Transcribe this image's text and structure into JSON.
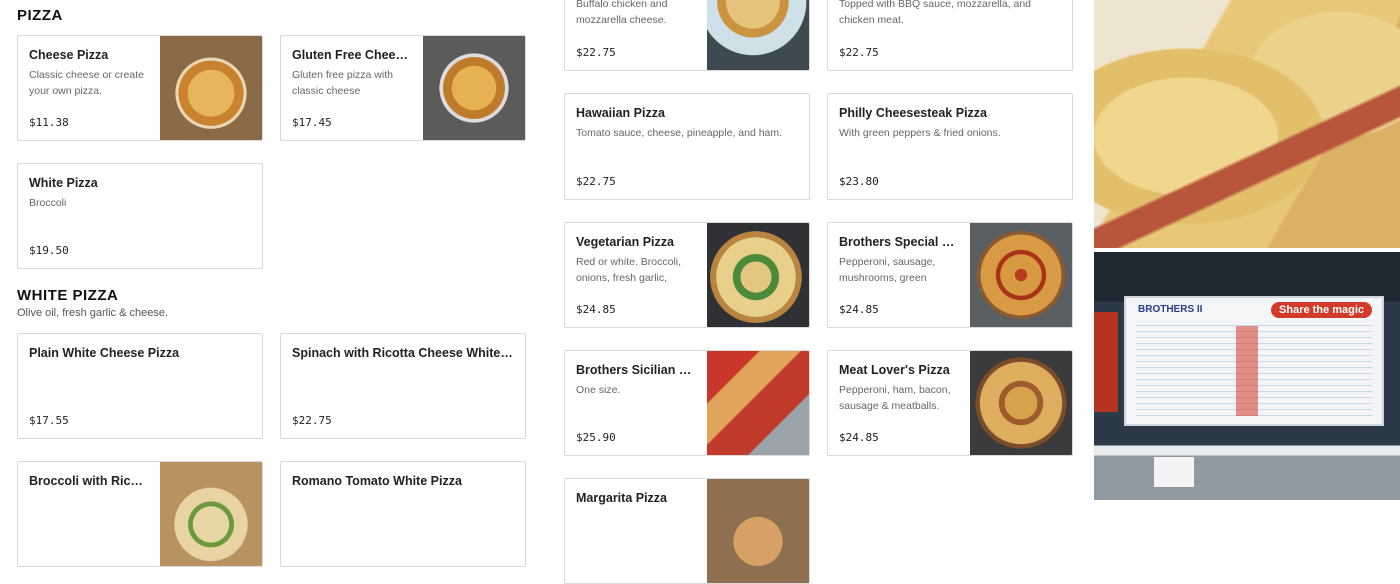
{
  "sections": {
    "pizza": {
      "title": "PIZZA"
    },
    "white_pizza": {
      "title": "WHITE PIZZA",
      "description": "Olive oil, fresh garlic & cheese."
    }
  },
  "items": {
    "cheese_pizza": {
      "name": "Cheese Pizza",
      "description": "Classic cheese or create your own pizza.",
      "price": "$11.38"
    },
    "gluten_free": {
      "name": "Gluten Free Cheese Pizza",
      "description": "Gluten free pizza with classic cheese",
      "price": "$17.45"
    },
    "white_pizza": {
      "name": "White Pizza",
      "description": "Broccoli",
      "price": "$19.50"
    },
    "plain_white": {
      "name": "Plain White Cheese Pizza",
      "description": "",
      "price": "$17.55"
    },
    "spinach_ricotta": {
      "name": "Spinach with Ricotta Cheese White Pizza",
      "description": "",
      "price": "$22.75"
    },
    "broccoli_ricotta": {
      "name": "Broccoli with Ricotta Cheese White Pizza",
      "description": "",
      "price": ""
    },
    "romano_tomato": {
      "name": "Romano Tomato White Pizza",
      "description": "",
      "price": ""
    },
    "buffalo": {
      "name": "",
      "description": "Buffalo chicken and mozzarella cheese.",
      "price": "$22.75"
    },
    "bbq": {
      "name": "",
      "description": "Topped with BBQ sauce, mozzarella, and chicken meat.",
      "price": "$22.75"
    },
    "hawaiian": {
      "name": "Hawaiian Pizza",
      "description": "Tomato sauce, cheese, pineapple, and ham.",
      "price": "$22.75"
    },
    "philly": {
      "name": "Philly Cheesesteak Pizza",
      "description": "With green peppers & fried onions.",
      "price": "$23.80"
    },
    "vegetarian": {
      "name": "Vegetarian Pizza",
      "description": "Red or white. Broccoli, onions, fresh garlic,",
      "price": "$24.85"
    },
    "brothers_special": {
      "name": "Brothers Special Pizza",
      "description": "Pepperoni, sausage, mushrooms, green",
      "price": "$24.85"
    },
    "sicilian": {
      "name": "Brothers Sicilian Pizza",
      "description": "One size.",
      "price": "$25.90"
    },
    "meat_lovers": {
      "name": "Meat Lover's Pizza",
      "description": "Pepperoni, ham, bacon, sausage & meatballs.",
      "price": "$24.85"
    },
    "margarita": {
      "name": "Margarita Pizza",
      "description": "",
      "price": ""
    }
  },
  "photos": {
    "menu_board_title": "BROTHERS II",
    "menu_board_tag": "Share the magic"
  },
  "colors": {
    "border": "#d9d9d9",
    "text": "#222222",
    "muted": "#666666"
  }
}
